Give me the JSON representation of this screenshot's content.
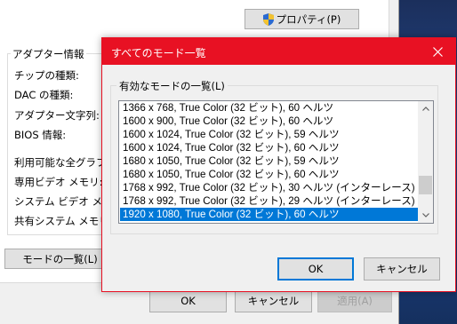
{
  "background_window": {
    "properties_button": "プロパティ(P)",
    "adapter_info_title": "アダプター情報",
    "rows": [
      "チップの種類:",
      "DAC の種類:",
      "アダプター文字列:",
      "BIOS 情報:",
      "利用可能な全グラフィ",
      "専用ビデオ メモリ:",
      "システム ビデオ メモリ:",
      "共有システム メモリ:"
    ],
    "mode_list_button": "モードの一覧(L)",
    "ok": "OK",
    "cancel": "キャンセル",
    "apply": "適用(A)"
  },
  "dialog": {
    "title": "すべてのモード一覧",
    "group_label": "有効なモードの一覧(L)",
    "modes": [
      "1366 x 768, True Color (32 ビット), 60 ヘルツ",
      "1600 x 900, True Color (32 ビット), 60 ヘルツ",
      "1600 x 1024, True Color (32 ビット), 59 ヘルツ",
      "1600 x 1024, True Color (32 ビット), 60 ヘルツ",
      "1680 x 1050, True Color (32 ビット), 59 ヘルツ",
      "1680 x 1050, True Color (32 ビット), 60 ヘルツ",
      "1768 x 992, True Color (32 ビット), 30 ヘルツ (インターレース)",
      "1768 x 992, True Color (32 ビット), 29 ヘルツ (インターレース)",
      "1920 x 1080, True Color (32 ビット), 60 ヘルツ"
    ],
    "selected_index": 8,
    "ok": "OK",
    "cancel": "キャンセル"
  },
  "colors": {
    "accent": "#0078d7",
    "titlebar": "#e81123"
  }
}
